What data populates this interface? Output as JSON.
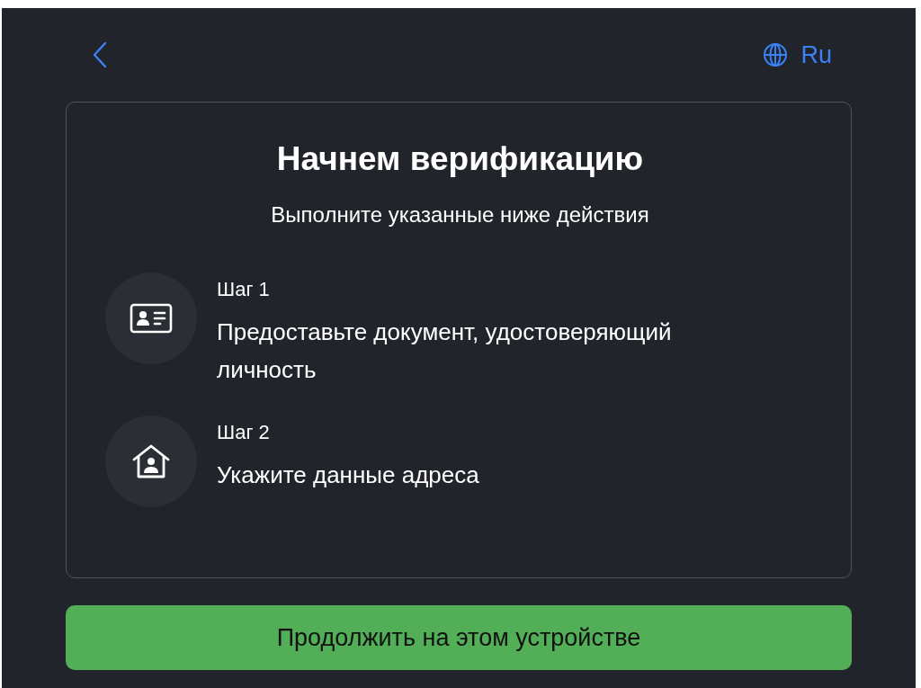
{
  "header": {
    "language": "Ru"
  },
  "card": {
    "title": "Начнем верификацию",
    "subtitle": "Выполните указанные ниже действия",
    "steps": [
      {
        "kind": "id-card",
        "label": "Шаг 1",
        "text": "Предоставьте документ, удостоверяющий личность"
      },
      {
        "kind": "home",
        "label": "Шаг 2",
        "text": "Укажите данные адреса"
      }
    ]
  },
  "button": "Продолжить на этом устройстве"
}
